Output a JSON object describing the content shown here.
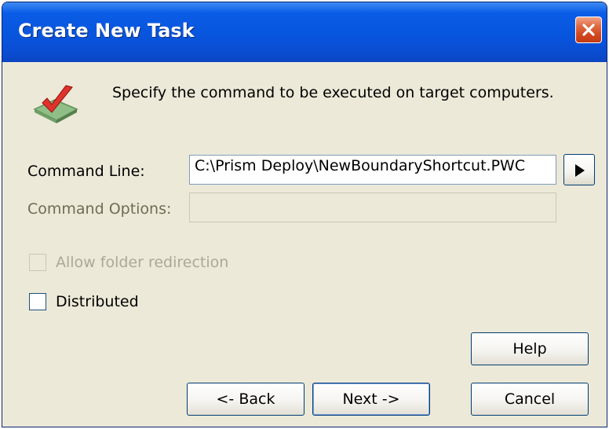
{
  "window": {
    "title": "Create New Task"
  },
  "header": {
    "instruction": "Specify the command to be executed on target computers.",
    "icon": "checkmark-task-icon"
  },
  "fields": {
    "command_line": {
      "label": "Command Line:",
      "value": "C:\\Prism Deploy\\NewBoundaryShortcut.PWC"
    },
    "command_options": {
      "label": "Command Options:",
      "value": "",
      "enabled": false
    }
  },
  "options": {
    "allow_folder_redirection": {
      "label": "Allow folder redirection",
      "checked": false,
      "enabled": false
    },
    "distributed": {
      "label": "Distributed",
      "checked": false,
      "enabled": true
    }
  },
  "buttons": {
    "help": "Help",
    "back": "<- Back",
    "next": "Next ->",
    "cancel": "Cancel"
  },
  "colors": {
    "titlebar": "#0855dd",
    "dialog_face": "#ece9d8",
    "close_button": "#d1461e"
  }
}
